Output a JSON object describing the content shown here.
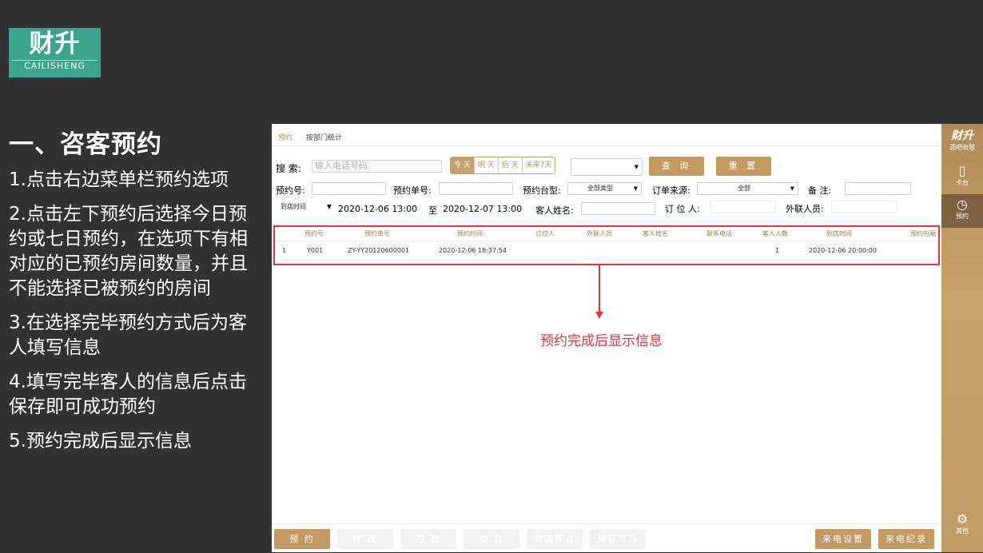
{
  "logo": {
    "main": "财升",
    "sub": "CAILISHENG"
  },
  "left_panel": {
    "title": "一、咨客预约",
    "steps": [
      "1.点击右边菜单栏预约选项",
      "2.点击左下预约后选择今日预约或七日预约，在选项下有相对应的已预约房间数量，并且不能选择已被预约的房间",
      "3.在选择完毕预约方式后为客人填写信息",
      "4.填写完毕客人的信息后点击保存即可成功预约",
      "5.预约完成后显示信息"
    ]
  },
  "tabs": [
    {
      "label": "预约",
      "active": true
    },
    {
      "label": "按部门统计",
      "active": false
    }
  ],
  "search": {
    "label": "搜 索:",
    "placeholder": "输入电话号码",
    "ranges": [
      "今 天",
      "明 天",
      "后 天",
      "未来7天"
    ],
    "dropdown_value": "",
    "query_button": "查 询",
    "reset_button": "重 置"
  },
  "filters": {
    "order_no_label": "预约号:",
    "order_single_label": "预约单号:",
    "table_type_label": "预约台型:",
    "table_type_value": "全部类型",
    "source_label": "订单来源:",
    "source_value": "全部",
    "note_label": "备 注:",
    "time_type_value": "到店时间",
    "date_from": "2020-12-06 13:00",
    "to_label": "至",
    "date_to": "2020-12-07 13:00",
    "guest_name_label": "客人姓名:",
    "booker_label": "订 位 人:",
    "external_label": "外联人员:"
  },
  "table": {
    "headers": [
      "预约号",
      "预约单号",
      "预约时间",
      "订位人",
      "外联人员",
      "客人姓名",
      "联系电话",
      "客人人数",
      "到店时间",
      "预约包厢"
    ],
    "rows": [
      {
        "idx": "1",
        "no": "Y001",
        "order": "ZY-YY20120600001",
        "time": "2020-12-06 18:37:54",
        "booker": "",
        "external": "",
        "guest": "",
        "phone": "",
        "count": "1",
        "arrive": "2020-12-06 20:00:00",
        "room": ""
      }
    ]
  },
  "annotation": "预约完成后显示信息",
  "bottom_buttons": {
    "reserve": "预 约",
    "edit": "修 改",
    "cancel": "撤 销",
    "change": "换 台",
    "open": "到店开台",
    "goods": "预订商品",
    "call_settings": "来电设置",
    "call_records": "来电纪录"
  },
  "sidebar": {
    "brand": "财升",
    "brand_sub": "酒吧收银",
    "table_label": "卡台",
    "reserve_label": "预约",
    "other_label": "其他"
  },
  "colors": {
    "accent": "#c49a62",
    "highlight": "#e8323d",
    "logo_bg": "#3aa58c",
    "bg": "#323232"
  }
}
